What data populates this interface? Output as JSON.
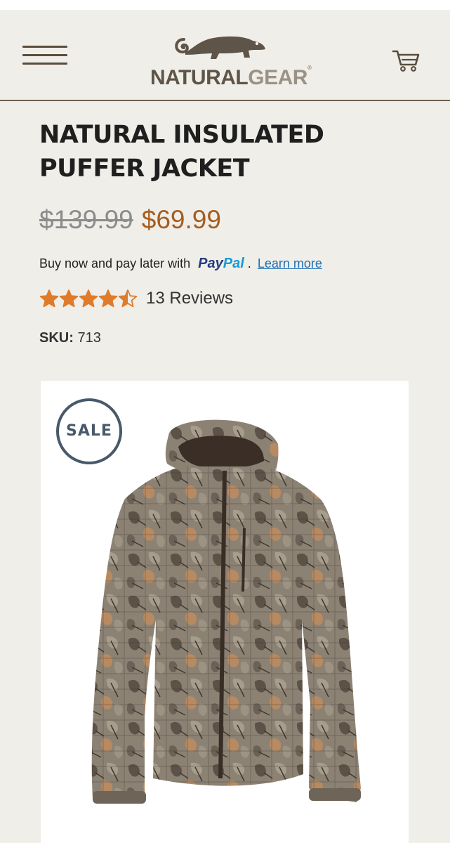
{
  "brand": {
    "name_part1": "NATURAL",
    "name_part2": "GEAR",
    "registered_mark": "®"
  },
  "header": {
    "menu_icon": "hamburger-icon",
    "cart_icon": "cart-icon"
  },
  "product": {
    "title": "NATURAL INSULATED PUFFER JACKET",
    "original_price": "$139.99",
    "sale_price": "$69.99",
    "paypal": {
      "text": "Buy now and pay later with",
      "logo_part1": "Pay",
      "logo_part2": "Pal",
      "separator": ".",
      "learn_more": "Learn more"
    },
    "rating": {
      "stars": 4.5,
      "max": 5,
      "reviews_label": "13 Reviews"
    },
    "sku_label": "SKU:",
    "sku_value": "713",
    "badge": "SALE"
  },
  "colors": {
    "background": "#efeee9",
    "price_sale": "#a65d1e",
    "price_old": "#8c8c8c",
    "star": "#e07b2a",
    "link": "#1f6fb5",
    "badge": "#48596a"
  }
}
